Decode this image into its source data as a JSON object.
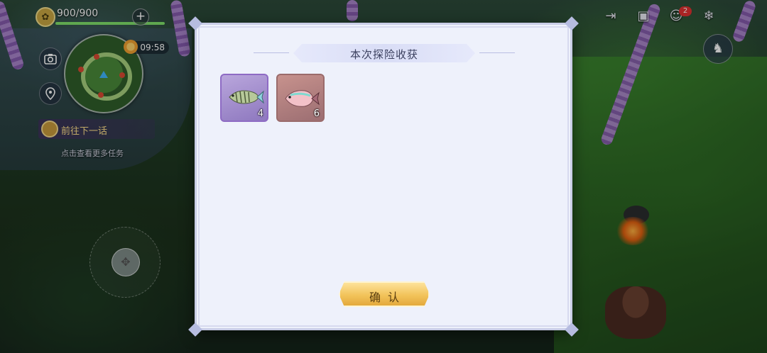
{
  "hud": {
    "hp_text": "900/900",
    "hp_fraction": 1.0,
    "hp_icon": "stamina-leaf-icon",
    "clock": "09:58",
    "quest_label": "前往下一话",
    "quest_hint": "点击查看更多任务",
    "notification_badge": "2"
  },
  "modal": {
    "title": "本次探险收获",
    "items": [
      {
        "icon": "fish-striped-icon",
        "qty": "4",
        "rarity_color": "#8e6bc4"
      },
      {
        "icon": "fish-pink-icon",
        "qty": "6",
        "rarity_color": "#9a6b6b"
      }
    ],
    "confirm_label": "确认"
  },
  "colors": {
    "confirm_gold": "#f2c35a",
    "panel_bg": "#eef1fb",
    "hp_green": "#7fe06a"
  }
}
